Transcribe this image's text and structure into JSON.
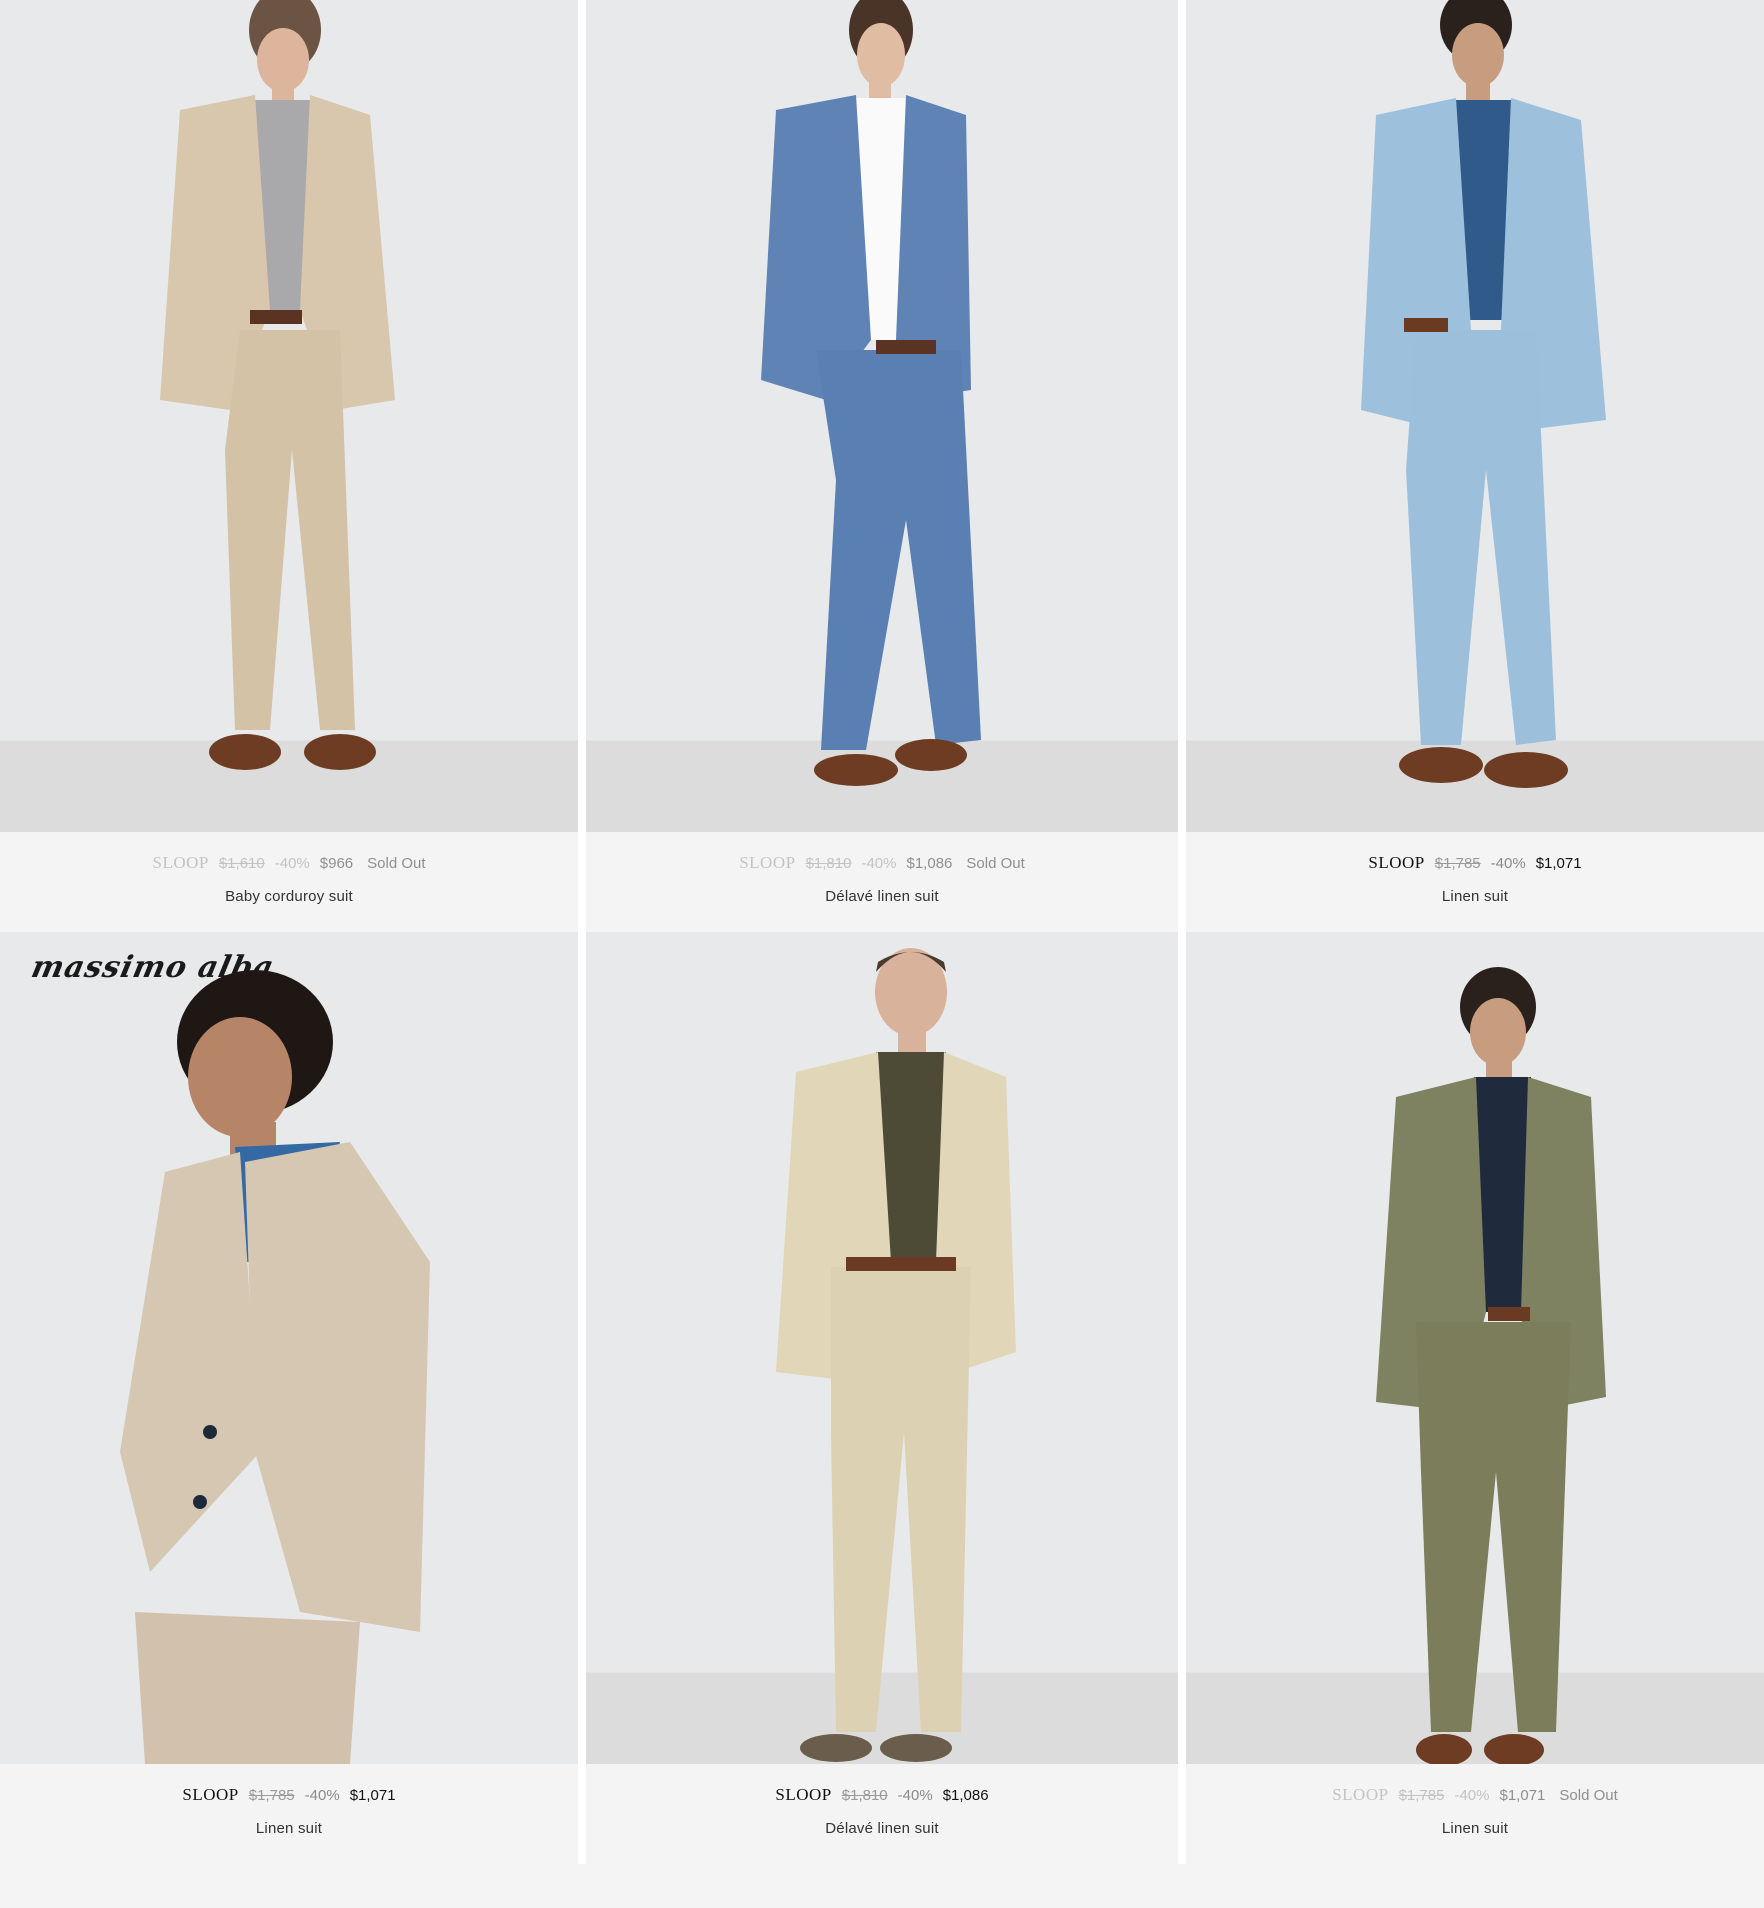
{
  "products": [
    {
      "brand": "SLOOP",
      "original_price": "$1,610",
      "discount": "-40%",
      "sale_price": "$966",
      "status": "Sold Out",
      "name": "Baby corduroy suit",
      "colors": {
        "jacket": "#d8c7ad",
        "pants": "#d3c2a6",
        "shirt": "#a9a8ab"
      }
    },
    {
      "brand": "SLOOP",
      "original_price": "$1,810",
      "discount": "-40%",
      "sale_price": "$1,086",
      "status": "Sold Out",
      "name": "Délavé linen suit",
      "colors": {
        "jacket": "#5f83b5",
        "pants": "#5a7fb2",
        "shirt": "#fafafa"
      }
    },
    {
      "brand": "SLOOP",
      "original_price": "$1,785",
      "discount": "-40%",
      "sale_price": "$1,071",
      "status": "",
      "name": "Linen suit",
      "colors": {
        "jacket": "#9dc1dc",
        "pants": "#9cc0dc",
        "shirt": "#2f5a8a"
      }
    },
    {
      "brand": "SLOOP",
      "original_price": "$1,785",
      "discount": "-40%",
      "sale_price": "$1,071",
      "status": "",
      "name": "Linen suit",
      "logo": "massimo alba",
      "colors": {
        "jacket": "#d6c7b3",
        "pants": "#d2c2ad",
        "shirt": "#3569a3"
      }
    },
    {
      "brand": "SLOOP",
      "original_price": "$1,810",
      "discount": "-40%",
      "sale_price": "$1,086",
      "status": "",
      "name": "Délavé linen suit",
      "colors": {
        "jacket": "#e1d6b8",
        "pants": "#ddd1b3",
        "shirt": "#4d4a36"
      }
    },
    {
      "brand": "SLOOP",
      "original_price": "$1,785",
      "discount": "-40%",
      "sale_price": "$1,071",
      "status": "Sold Out",
      "name": "Linen suit",
      "colors": {
        "jacket": "#7f8260",
        "pants": "#7b7d5b",
        "shirt": "#1f2a3d"
      }
    }
  ]
}
